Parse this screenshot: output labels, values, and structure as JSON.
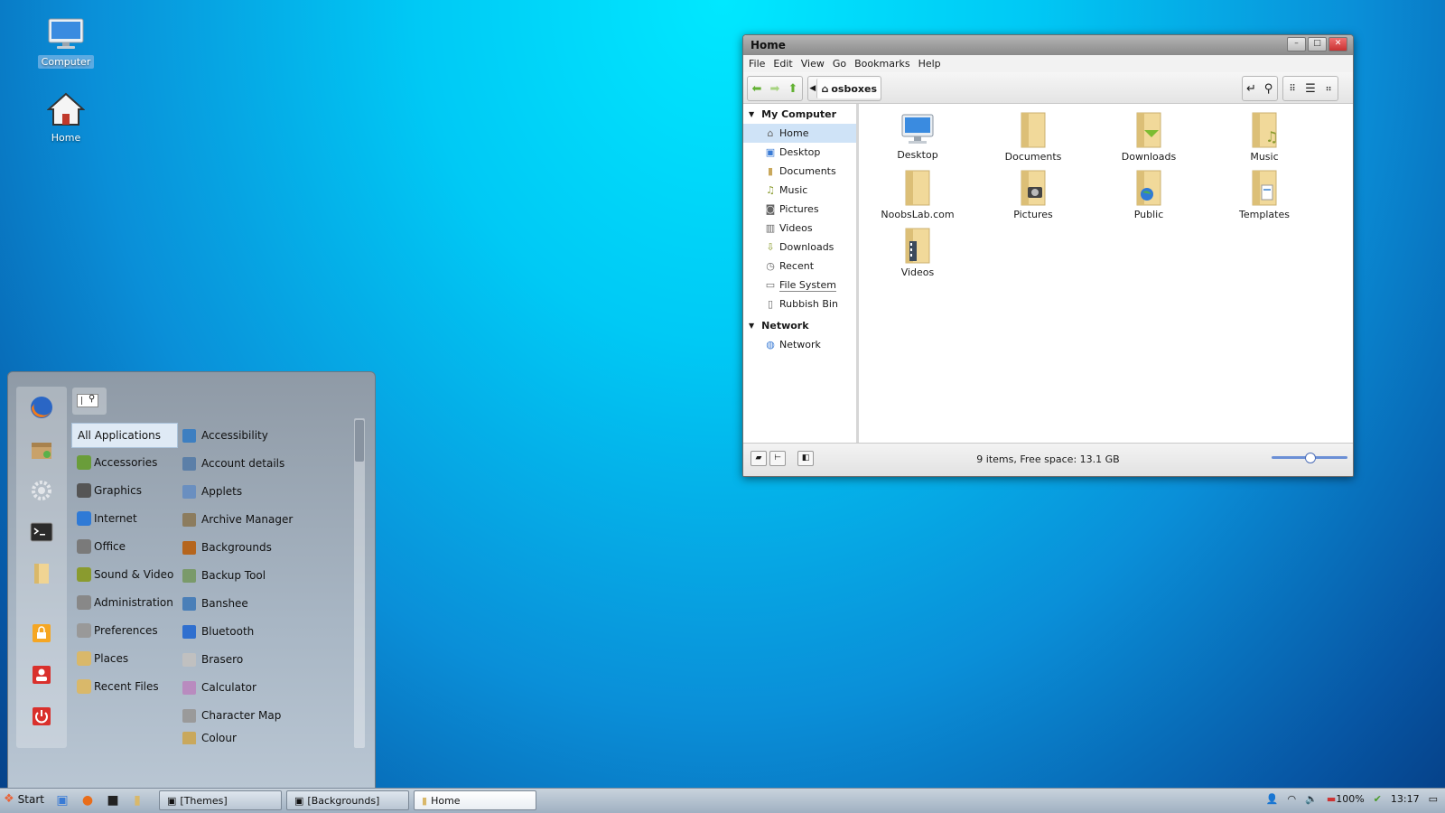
{
  "desktop": {
    "icons": [
      {
        "label": "Computer"
      },
      {
        "label": "Home"
      }
    ]
  },
  "window": {
    "title": "Home",
    "menu": [
      "File",
      "Edit",
      "View",
      "Go",
      "Bookmarks",
      "Help"
    ],
    "location": "osboxes",
    "sidebar": {
      "my_computer": "My Computer",
      "items": [
        "Home",
        "Desktop",
        "Documents",
        "Music",
        "Pictures",
        "Videos",
        "Downloads",
        "Recent",
        "File System",
        "Rubbish Bin"
      ],
      "network_header": "Network",
      "network_items": [
        "Network"
      ]
    },
    "files": [
      "Desktop",
      "Documents",
      "Downloads",
      "Music",
      "NoobsLab.com",
      "Pictures",
      "Public",
      "Templates",
      "Videos"
    ],
    "status": "9 items, Free space: 13.1 GB",
    "zoom_level": 0.5
  },
  "startmenu": {
    "search_value": "|",
    "categories": [
      "All Applications",
      "Accessories",
      "Graphics",
      "Internet",
      "Office",
      "Sound & Video",
      "Administration",
      "Preferences",
      "Places",
      "Recent Files"
    ],
    "apps": [
      "Accessibility",
      "Account details",
      "Applets",
      "Archive Manager",
      "Backgrounds",
      "Backup Tool",
      "Banshee",
      "Bluetooth",
      "Brasero",
      "Calculator",
      "Character Map",
      "Colour"
    ]
  },
  "taskbar": {
    "start_label": "Start",
    "tasks": [
      "[Themes]",
      "[Backgrounds]",
      "Home"
    ],
    "battery": "100%",
    "clock": "13:17"
  },
  "colors": {
    "accent": "#cfe3f7",
    "desktop_top": "#00e8ff",
    "desktop_bottom": "#053f86"
  }
}
